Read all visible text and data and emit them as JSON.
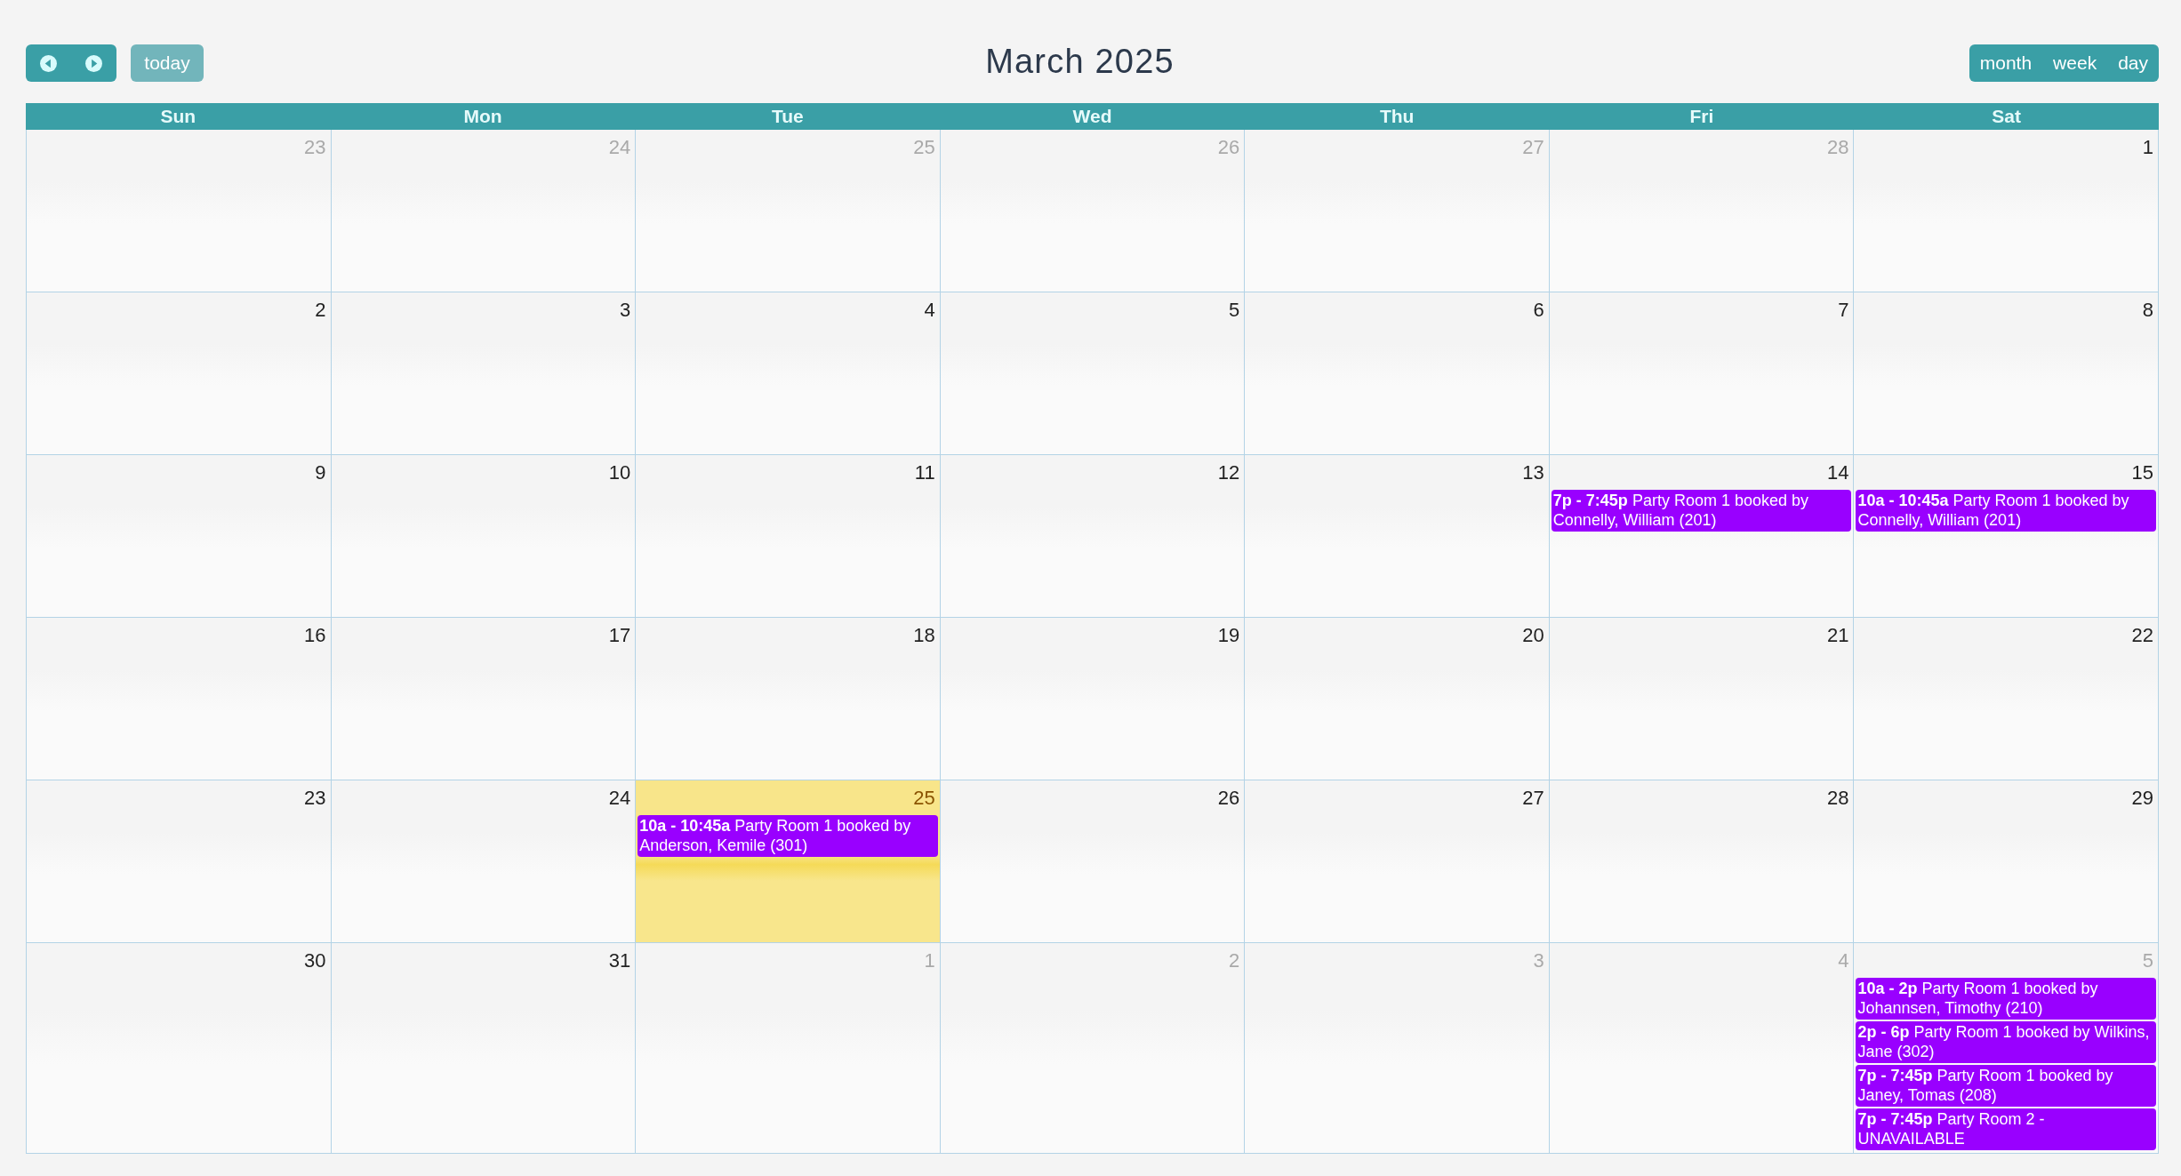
{
  "toolbar": {
    "today_button": {
      "label": "today",
      "disabled": true
    },
    "title": "March 2025",
    "views": [
      "month",
      "week",
      "day"
    ]
  },
  "weekdays": [
    "Sun",
    "Mon",
    "Tue",
    "Wed",
    "Thu",
    "Fri",
    "Sat"
  ],
  "weeks": [
    {
      "days": [
        {
          "date": "23",
          "outside": true,
          "today": false
        },
        {
          "date": "24",
          "outside": true,
          "today": false
        },
        {
          "date": "25",
          "outside": true,
          "today": false
        },
        {
          "date": "26",
          "outside": true,
          "today": false
        },
        {
          "date": "27",
          "outside": true,
          "today": false
        },
        {
          "date": "28",
          "outside": true,
          "today": false
        },
        {
          "date": "1",
          "outside": false,
          "today": false
        }
      ]
    },
    {
      "days": [
        {
          "date": "2",
          "outside": false,
          "today": false
        },
        {
          "date": "3",
          "outside": false,
          "today": false
        },
        {
          "date": "4",
          "outside": false,
          "today": false
        },
        {
          "date": "5",
          "outside": false,
          "today": false
        },
        {
          "date": "6",
          "outside": false,
          "today": false
        },
        {
          "date": "7",
          "outside": false,
          "today": false
        },
        {
          "date": "8",
          "outside": false,
          "today": false
        }
      ]
    },
    {
      "days": [
        {
          "date": "9",
          "outside": false,
          "today": false
        },
        {
          "date": "10",
          "outside": false,
          "today": false
        },
        {
          "date": "11",
          "outside": false,
          "today": false
        },
        {
          "date": "12",
          "outside": false,
          "today": false
        },
        {
          "date": "13",
          "outside": false,
          "today": false
        },
        {
          "date": "14",
          "outside": false,
          "today": false,
          "events": [
            "**7p - 7:45p** Party Room 1 booked by Connelly, William (201)"
          ]
        },
        {
          "date": "15",
          "outside": false,
          "today": false,
          "events": [
            "**10a - 10:45a** Party Room 1 booked by Connelly, William (201)"
          ]
        }
      ]
    },
    {
      "days": [
        {
          "date": "16",
          "outside": false,
          "today": false
        },
        {
          "date": "17",
          "outside": false,
          "today": false
        },
        {
          "date": "18",
          "outside": false,
          "today": false
        },
        {
          "date": "19",
          "outside": false,
          "today": false
        },
        {
          "date": "20",
          "outside": false,
          "today": false
        },
        {
          "date": "21",
          "outside": false,
          "today": false
        },
        {
          "date": "22",
          "outside": false,
          "today": false
        }
      ]
    },
    {
      "days": [
        {
          "date": "23",
          "outside": false,
          "today": false
        },
        {
          "date": "24",
          "outside": false,
          "today": false
        },
        {
          "date": "25",
          "outside": false,
          "today": true,
          "events": [
            "**10a - 10:45a** Party Room 1 booked by Anderson, Kemile (301)"
          ]
        },
        {
          "date": "26",
          "outside": false,
          "today": false
        },
        {
          "date": "27",
          "outside": false,
          "today": false
        },
        {
          "date": "28",
          "outside": false,
          "today": false
        },
        {
          "date": "29",
          "outside": false,
          "today": false
        }
      ]
    },
    {
      "days": [
        {
          "date": "30",
          "outside": false,
          "today": false
        },
        {
          "date": "31",
          "outside": false,
          "today": false
        },
        {
          "date": "1",
          "outside": true,
          "today": false
        },
        {
          "date": "2",
          "outside": true,
          "today": false
        },
        {
          "date": "3",
          "outside": true,
          "today": false
        },
        {
          "date": "4",
          "outside": true,
          "today": false
        },
        {
          "date": "5",
          "outside": true,
          "today": false,
          "events": [
            "**10a - 2p** Party Room 1 booked by Johannsen, Timothy (210)",
            "**2p - 6p** Party Room 1 booked by Wilkins, Jane (302)",
            "**7p - 7:45p** Party Room 1 booked by Janey, Tomas (208)",
            "**7p - 7:45p** Party Room 2 - UNAVAILABLE"
          ]
        }
      ]
    }
  ]
}
